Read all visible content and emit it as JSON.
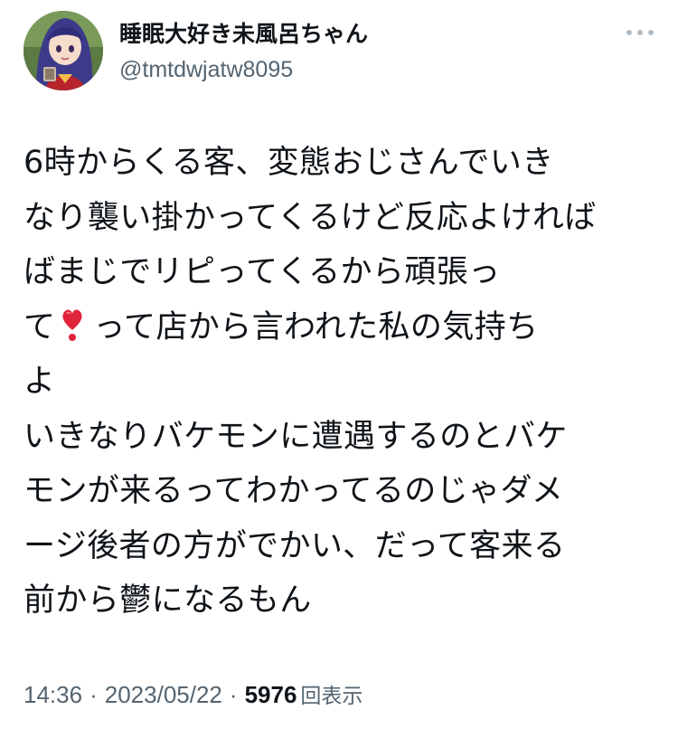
{
  "tweet": {
    "display_name": "睡眠大好き未風呂ちゃん",
    "handle": "@tmtdwjatw8095",
    "more_icon": "more-horizontal-icon",
    "body": {
      "line1": "6時からくる客、変態おじさんでいき",
      "line2": "なり襲い掛かってくるけど反応よければ",
      "line3": "ばまじでリピってくるから頑張っ",
      "line4_before_emoji": "て",
      "line4_emoji": "❣️",
      "line4_after_emoji": "って店から言われた私の気持ち",
      "line5": "よ",
      "line6": "いきなりバケモンに遭遇するのとバケ",
      "line7": "モンが来るってわかってるのじゃダメ",
      "line8": "ージ後者の方がでかい、だって客来る",
      "line9": "前から鬱になるもん"
    },
    "time": "14:36",
    "separator": "·",
    "date": "2023/05/22",
    "views_count": "5976",
    "views_label": "回表示"
  },
  "colors": {
    "text_primary": "#0f1419",
    "text_secondary": "#536471",
    "heart": "#e0243b"
  }
}
